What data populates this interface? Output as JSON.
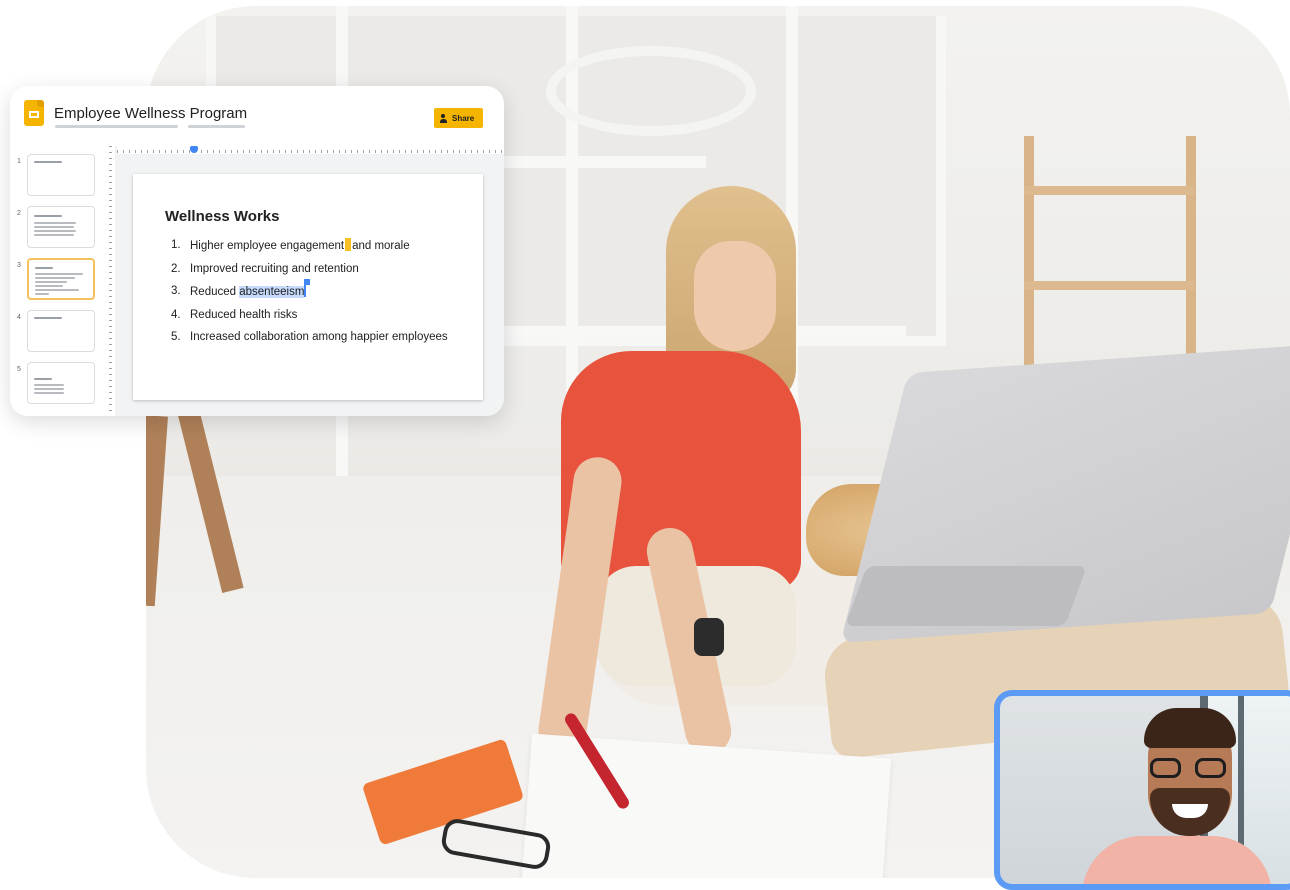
{
  "app": {
    "icon": "slides-logo-icon",
    "doc_title": "Employee Wellness Program",
    "share_label": "Share",
    "accent_color": "#f5b400"
  },
  "filmstrip": {
    "selected": 3,
    "slides": [
      {
        "number": "1"
      },
      {
        "number": "2"
      },
      {
        "number": "3"
      },
      {
        "number": "4"
      },
      {
        "number": "5"
      }
    ]
  },
  "slide": {
    "title": "Wellness Works",
    "items": [
      {
        "num": "1.",
        "text_before": "Higher employee engagement",
        "text_after": "and morale"
      },
      {
        "num": "2.",
        "text": "Improved recruiting and retention"
      },
      {
        "num": "3.",
        "text_before": "Reduced ",
        "highlight": "absenteeism"
      },
      {
        "num": "4.",
        "text": "Reduced health risks"
      },
      {
        "num": "5.",
        "text": "Increased collaboration among happier employees"
      }
    ]
  },
  "video_call": {
    "highlight_color": "#5b9af5"
  }
}
